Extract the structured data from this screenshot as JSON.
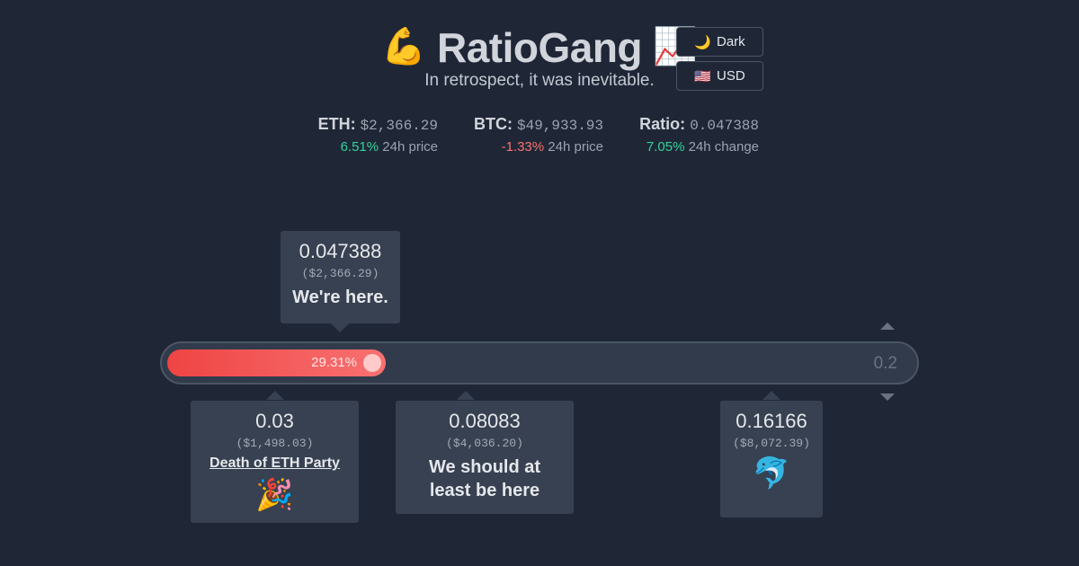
{
  "header": {
    "icon_left": "💪",
    "title": "RatioGang",
    "icon_right": "📈",
    "subtitle": "In retrospect, it was inevitable."
  },
  "controls": {
    "theme": {
      "icon": "🌙",
      "label": "Dark"
    },
    "currency": {
      "icon": "🇺🇸",
      "label": "USD"
    }
  },
  "stats": {
    "eth": {
      "label": "ETH:",
      "value": "$2,366.29",
      "change": "6.51%",
      "change_text": "24h price"
    },
    "btc": {
      "label": "BTC:",
      "value": "$49,933.93",
      "change": "-1.33%",
      "change_text": "24h price"
    },
    "ratio": {
      "label": "Ratio:",
      "value": "0.047388",
      "change": "7.05%",
      "change_text": "24h change"
    }
  },
  "current": {
    "ratio": "0.047388",
    "usd": "($2,366.29)",
    "label": "We're here."
  },
  "slider": {
    "percent_label": "29.31%",
    "fill_fraction": 0.2931,
    "max": "0.2"
  },
  "markers": [
    {
      "ratio": "0.03",
      "usd": "($1,498.03)",
      "link": "Death of ETH Party",
      "emoji": "🎉"
    },
    {
      "ratio": "0.08083",
      "usd": "($4,036.20)",
      "label": "We should at least be here"
    },
    {
      "ratio": "0.16166",
      "usd": "($8,072.39)",
      "emoji": "🐬"
    }
  ],
  "colors": {
    "background": "#1f2737",
    "positive": "#34d399",
    "negative": "#f87171",
    "fill": "#ef4444"
  }
}
